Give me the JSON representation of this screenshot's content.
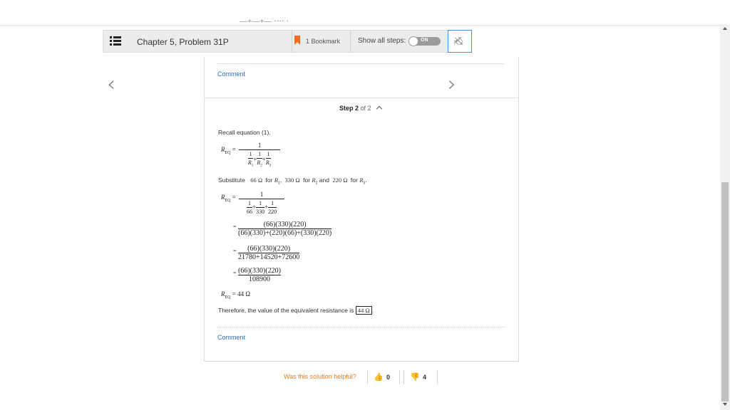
{
  "toolbar": {
    "title": "Chapter 5, Problem 31P",
    "bookmark_label": "1 Bookmark",
    "show_steps_label": "Show all steps:",
    "toggle_state": "ON"
  },
  "solution": {
    "comment_label": "Comment",
    "step_current": "Step 2",
    "step_total": "of 2",
    "recall_text": "Recall equation (1).",
    "substitute": {
      "word": "Substitute",
      "v1": "66 Ω",
      "for": "for",
      "r1": "R",
      "r1_sub": "1",
      "v2": "330 Ω",
      "r2": "R",
      "r2_sub": "2",
      "and": "and",
      "v3": "220 Ω",
      "r3": "R",
      "r3_sub": "3"
    },
    "req_symbol": "R",
    "req_sub": "EQ",
    "eq1": {
      "num": "1",
      "terms": [
        "1",
        "1",
        "1"
      ],
      "den_terms": [
        "R1",
        "R2",
        "R3"
      ]
    },
    "eq2": {
      "num": "1",
      "terms": [
        "1",
        "1",
        "1"
      ],
      "den_terms": [
        "66",
        "330",
        "220"
      ]
    },
    "eq3": {
      "num": "(66)(330)(220)",
      "den": "(66)(330)+(220)(66)+(330)(220)"
    },
    "eq4": {
      "num": "(66)(330)(220)",
      "den": "21780+14520+72600"
    },
    "eq5": {
      "num": "(66)(330)(220)",
      "den": "108900"
    },
    "result_value": "= 44 Ω",
    "therefore_text": "Therefore, the value of the equivalent resistance is",
    "answer_boxed": "44 Ω"
  },
  "feedback": {
    "helpful_label": "Was this solution helpful?",
    "upvotes": "0",
    "downvotes": "4"
  },
  "colors": {
    "accent_orange": "#f36c21",
    "link_blue": "#2a6ebb",
    "helpful_orange": "#e87b1d",
    "downvote_red": "#e0402a"
  }
}
